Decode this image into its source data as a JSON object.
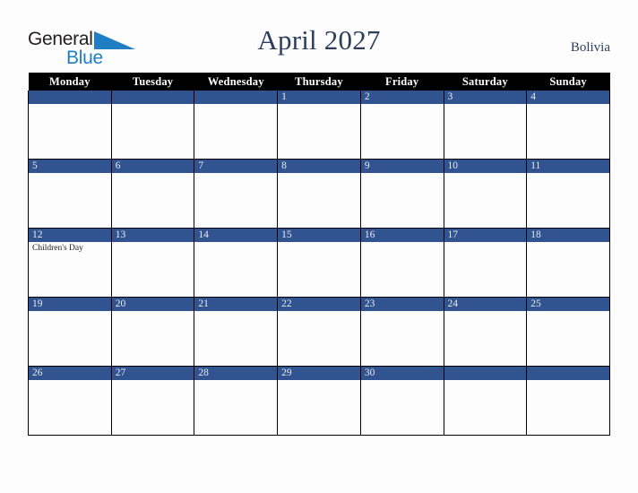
{
  "brand": {
    "name_part1": "General",
    "name_part2": "Blue",
    "triangle_icon": "blue-triangle-icon",
    "color_dark": "#231f20",
    "color_blue": "#1f7ec4"
  },
  "header": {
    "title": "April 2027",
    "country": "Bolivia",
    "title_color": "#2c3e5d"
  },
  "calendar": {
    "weekdays": [
      "Monday",
      "Tuesday",
      "Wednesday",
      "Thursday",
      "Friday",
      "Saturday",
      "Sunday"
    ],
    "header_bg": "#000000",
    "header_text": "#ffffff",
    "daybar_bg": "#31538f",
    "daybar_text": "#e8ecf5",
    "cell_bg": "#fdfdfd",
    "border_color": "#000000",
    "weeks": [
      [
        {
          "day": "",
          "events": []
        },
        {
          "day": "",
          "events": []
        },
        {
          "day": "",
          "events": []
        },
        {
          "day": "1",
          "events": []
        },
        {
          "day": "2",
          "events": []
        },
        {
          "day": "3",
          "events": []
        },
        {
          "day": "4",
          "events": []
        }
      ],
      [
        {
          "day": "5",
          "events": []
        },
        {
          "day": "6",
          "events": []
        },
        {
          "day": "7",
          "events": []
        },
        {
          "day": "8",
          "events": []
        },
        {
          "day": "9",
          "events": []
        },
        {
          "day": "10",
          "events": []
        },
        {
          "day": "11",
          "events": []
        }
      ],
      [
        {
          "day": "12",
          "events": [
            "Children's Day"
          ]
        },
        {
          "day": "13",
          "events": []
        },
        {
          "day": "14",
          "events": []
        },
        {
          "day": "15",
          "events": []
        },
        {
          "day": "16",
          "events": []
        },
        {
          "day": "17",
          "events": []
        },
        {
          "day": "18",
          "events": []
        }
      ],
      [
        {
          "day": "19",
          "events": []
        },
        {
          "day": "20",
          "events": []
        },
        {
          "day": "21",
          "events": []
        },
        {
          "day": "22",
          "events": []
        },
        {
          "day": "23",
          "events": []
        },
        {
          "day": "24",
          "events": []
        },
        {
          "day": "25",
          "events": []
        }
      ],
      [
        {
          "day": "26",
          "events": []
        },
        {
          "day": "27",
          "events": []
        },
        {
          "day": "28",
          "events": []
        },
        {
          "day": "29",
          "events": []
        },
        {
          "day": "30",
          "events": []
        },
        {
          "day": "",
          "events": []
        },
        {
          "day": "",
          "events": []
        }
      ]
    ]
  }
}
